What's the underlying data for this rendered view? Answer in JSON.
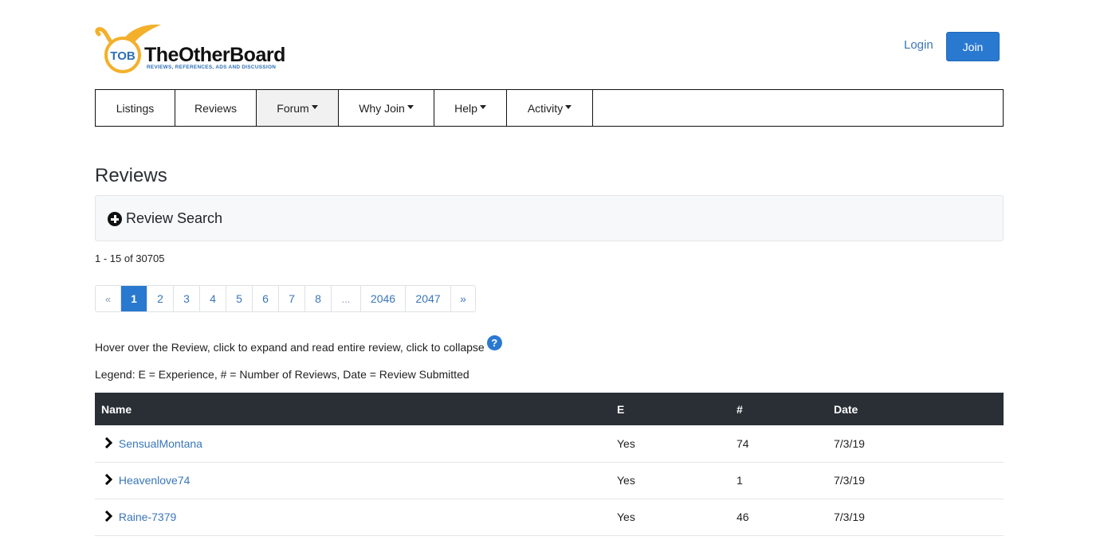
{
  "header": {
    "logo": {
      "badge": "TOB",
      "name": "TheOtherBoard",
      "tagline": "REVIEWS, REFERENCES, ADS AND DISCUSSION"
    },
    "login_label": "Login",
    "join_label": "Join"
  },
  "nav": {
    "items": [
      {
        "label": "Listings",
        "dropdown": false
      },
      {
        "label": "Reviews",
        "dropdown": false
      },
      {
        "label": "Forum",
        "dropdown": true,
        "active": true
      },
      {
        "label": "Why Join",
        "dropdown": true
      },
      {
        "label": "Help",
        "dropdown": true
      },
      {
        "label": "Activity",
        "dropdown": true
      }
    ]
  },
  "main": {
    "title": "Reviews",
    "search_panel_label": "Review Search",
    "result_count": "1 - 15 of 30705",
    "pagination": {
      "prev": "«",
      "pages": [
        "1",
        "2",
        "3",
        "4",
        "5",
        "6",
        "7",
        "8",
        "...",
        "2046",
        "2047"
      ],
      "current": "1",
      "next": "»"
    },
    "hint": "Hover over the Review, click to expand and read entire review, click to collapse",
    "help_icon_glyph": "?",
    "legend": "Legend: E = Experience, # = Number of Reviews, Date = Review Submitted"
  },
  "table": {
    "columns": [
      "Name",
      "E",
      "#",
      "Date"
    ],
    "rows": [
      {
        "name": "SensualMontana",
        "e": "Yes",
        "count": "74",
        "date": "7/3/19"
      },
      {
        "name": "Heavenlove74",
        "e": "Yes",
        "count": "1",
        "date": "7/3/19"
      },
      {
        "name": "Raine-7379",
        "e": "Yes",
        "count": "46",
        "date": "7/3/19"
      }
    ]
  },
  "colors": {
    "primary": "#2a79d1",
    "link": "#3a76b9",
    "table_header": "#2a2f36",
    "logo_orange": "#f3b02b",
    "logo_blue": "#2d6fb6"
  }
}
